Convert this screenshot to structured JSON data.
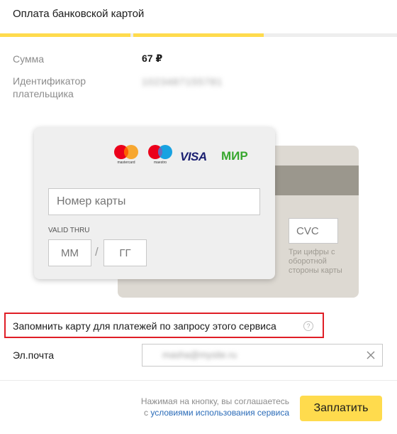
{
  "header": {
    "title": "Оплата банковской картой"
  },
  "progress": {
    "completed_segments": 2
  },
  "info": {
    "amount_label": "Сумма",
    "amount_value": "67 ₽",
    "payer_id_label": "Идентификатор плательщика",
    "payer_id_value": "1023487155781"
  },
  "card": {
    "logos": {
      "mastercard": "mastercard",
      "maestro": "maestro",
      "visa": "VISA",
      "mir": "МИР"
    },
    "number_placeholder": "Номер карты",
    "valid_thru_label": "VALID THRU",
    "month_placeholder": "ММ",
    "year_placeholder": "ГГ",
    "separator": "/",
    "cvc_placeholder": "CVC",
    "cvc_hint": "Три цифры с оборотной стороны карты"
  },
  "remember": {
    "label": "Запомнить карту для платежей по запросу этого сервиса",
    "help": "?"
  },
  "email": {
    "label": "Эл.почта",
    "value": "masha@mysite.ru"
  },
  "footer": {
    "notice_line1": "Нажимая на кнопку, вы соглашаетесь",
    "notice_prefix": "с ",
    "terms_link": "условиями использования сервиса",
    "pay_label": "Заплатить"
  },
  "colors": {
    "accent": "#ffdb4d",
    "highlight_border": "#e01e26",
    "link": "#2a6bb8"
  }
}
